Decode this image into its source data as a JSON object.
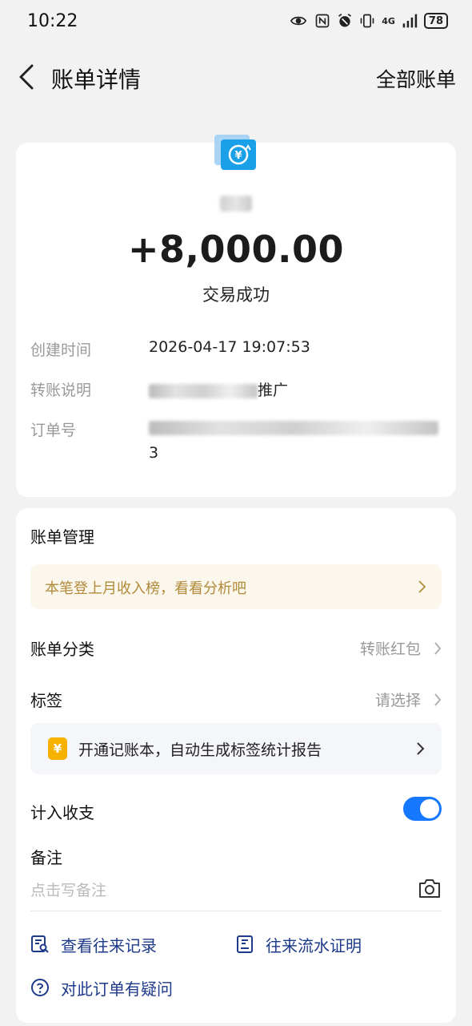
{
  "status_bar": {
    "time": "10:22",
    "network": "4G",
    "battery": "78",
    "icons": [
      "eye-icon",
      "nfc-icon",
      "alarm-icon",
      "vibrate-icon",
      "signal-icon"
    ]
  },
  "header": {
    "back_icon": "chevron-left-icon",
    "title": "账单详情",
    "all_bills": "全部账单"
  },
  "summary": {
    "icon": "yuan-transfer-icon",
    "amount": "+8,000.00",
    "status": "交易成功"
  },
  "details": {
    "created_label": "创建时间",
    "created_value": "2026-04-17 19:07:53",
    "note_label": "转账说明",
    "note_value_suffix": "推广",
    "order_label": "订单号",
    "order_value_tail": "3"
  },
  "management": {
    "title": "账单管理",
    "promo_text": "本笔登上月收入榜，看看分析吧",
    "category_label": "账单分类",
    "category_value": "转账红包",
    "tag_label": "标签",
    "tag_value": "请选择",
    "ledger_icon_glyph": "¥",
    "ledger_text": "开通记账本，自动生成标签统计报告",
    "income_label": "计入收支",
    "income_toggle_on": true,
    "remark_label": "备注",
    "remark_placeholder": "点击写备注",
    "history_link": "查看往来记录",
    "statement_link": "往来流水证明",
    "question_link": "对此订单有疑问"
  },
  "colors": {
    "accent": "#1677ff",
    "promo_bg": "#fbf7ec",
    "promo_text": "#b08a3a",
    "link_text": "#1e3a8a"
  }
}
